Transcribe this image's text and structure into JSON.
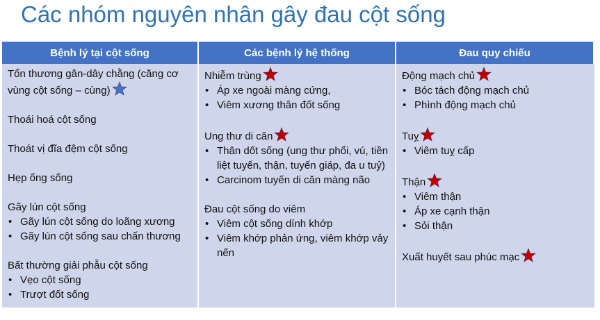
{
  "title": "Các nhóm nguyên nhân gây đau cột sống",
  "colors": {
    "header_bg": "#4472c4",
    "cell_bg": "#cfd5ea",
    "title": "#2e74b5",
    "star_red": "#c00000",
    "star_blue": "#4472c4"
  },
  "columns": [
    {
      "header": "Bệnh lý tại cột sống",
      "groups": [
        {
          "head": "Tổn thương gân-dây chằng (căng cơ vùng cột sống – cùng)",
          "icon": "blue-star-icon",
          "items": []
        },
        {
          "head": "Thoái hoá cột sống",
          "items": []
        },
        {
          "head": "Thoát vị đĩa đệm cột sống",
          "items": []
        },
        {
          "head": "Hẹp ống sống",
          "items": []
        },
        {
          "head": "Gãy lún cột sống",
          "items": [
            "Gãy lún cột sống do loãng xương",
            "Gãy lún cột sống sau chấn thương"
          ]
        },
        {
          "head": "Bất thường giải phẫu cột sống",
          "items": [
            "Vẹo cột sống",
            "Trượt đốt sống"
          ]
        }
      ]
    },
    {
      "header": "Các bệnh lý hệ thống",
      "groups": [
        {
          "head": "Nhiễm trùng",
          "icon": "red-star-icon",
          "items": [
            "Áp xe ngoài màng cứng,",
            "Viêm xương thân đốt sống"
          ]
        },
        {
          "head": "Ung thư di căn",
          "icon": "red-star-icon",
          "items": [
            "Thân dốt sống (ung thư phổi, vú, tiền liệt tuyến, thận, tuyến giáp, đa u tuỷ)",
            "Carcinom tuyến di căn màng não"
          ]
        },
        {
          "head": "Đau cột sống do viêm",
          "items": [
            "Viêm cột sống dính khớp",
            "Viêm khớp phản ứng, viêm khớp vảy nến"
          ]
        }
      ]
    },
    {
      "header": "Đau quy chiếu",
      "groups": [
        {
          "head": "Động mạch chủ",
          "icon": "red-star-icon",
          "items": [
            "Bóc tách động mạch chủ",
            "Phình động mạch chủ"
          ]
        },
        {
          "head": "Tuỵ",
          "icon": "red-star-icon",
          "items": [
            "Viêm tuỵ cấp"
          ]
        },
        {
          "head": "Thận",
          "icon": "red-star-icon",
          "items": [
            "Viêm thận",
            "Áp xe cạnh thận",
            "Sỏi thận"
          ]
        },
        {
          "head": "Xuất huyết sau phúc mạc",
          "icon": "red-star-icon",
          "items": []
        }
      ]
    }
  ]
}
